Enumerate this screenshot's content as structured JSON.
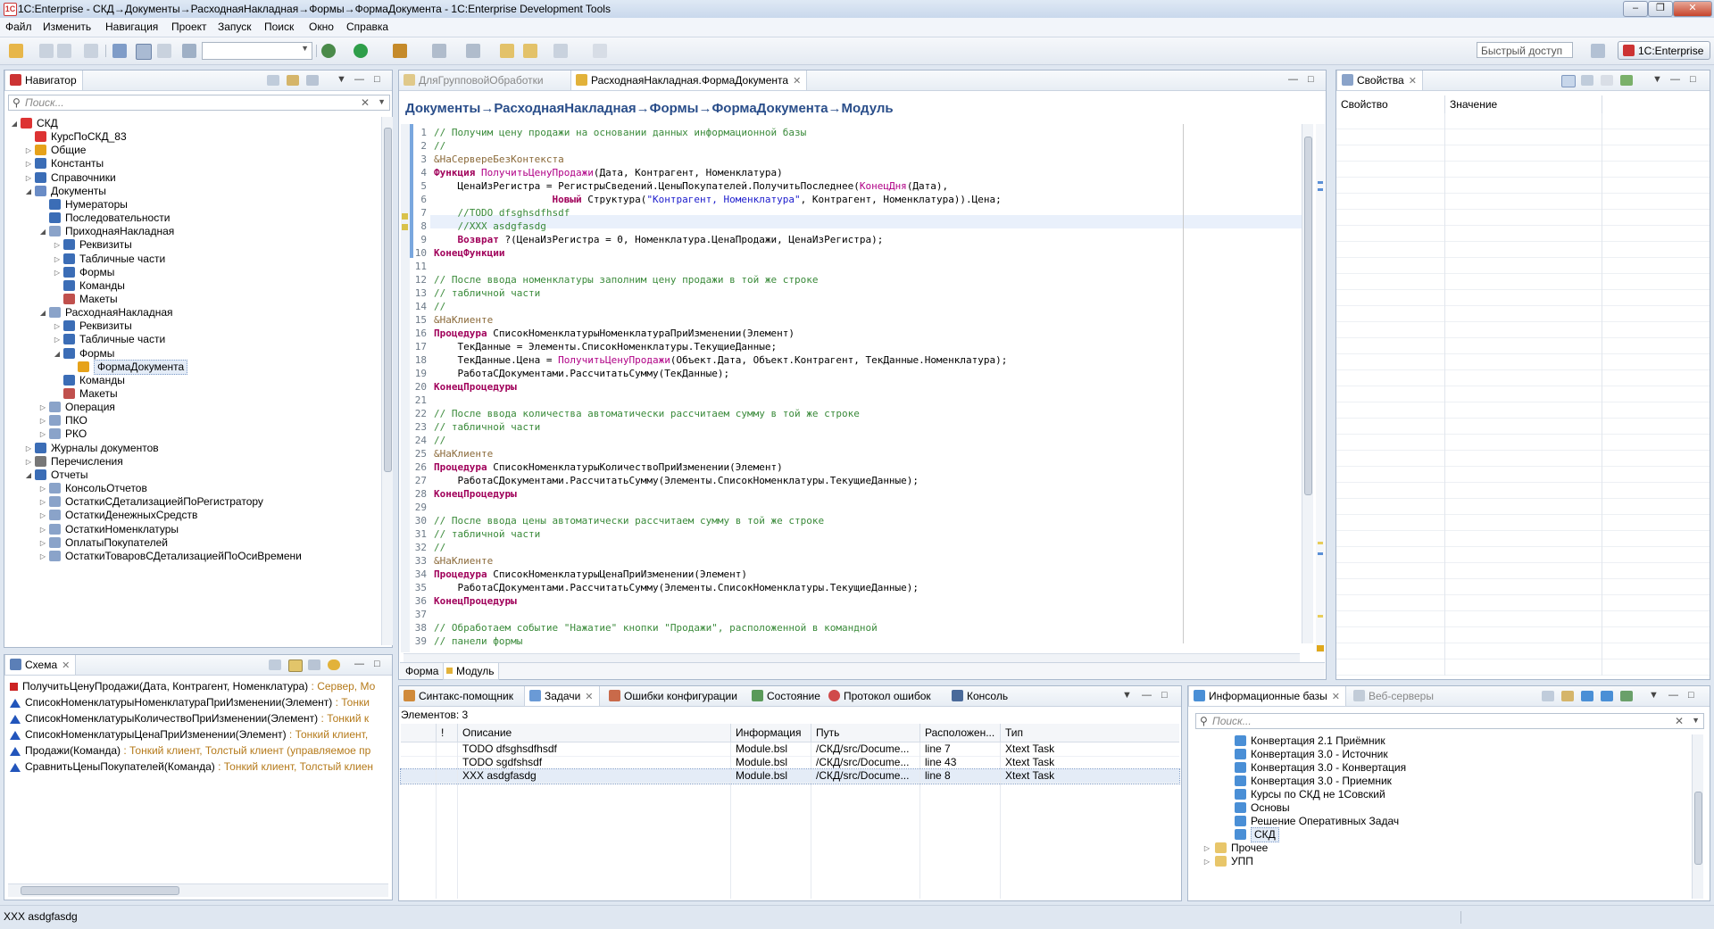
{
  "window": {
    "title": "1C:Enterprise - СКД→Документы→РасходнаяНакладная→Формы→ФормаДокумента - 1C:Enterprise Development Tools",
    "app_icon_text": "1C"
  },
  "menu": [
    "Файл",
    "Изменить",
    "Навигация",
    "Проект",
    "Запуск",
    "Поиск",
    "Окно",
    "Справка"
  ],
  "toolbar": {
    "quick_access_placeholder": "Быстрый доступ",
    "perspective": "1C:Enterprise"
  },
  "navigator": {
    "title": "Навигатор",
    "search_placeholder": "Поиск...",
    "items": [
      {
        "label": "СКД",
        "level": 0,
        "twisty": "open",
        "icon": "project-icon",
        "color": "#d33"
      },
      {
        "label": "КурсПоСКД_83",
        "level": 1,
        "twisty": "none",
        "icon": "config-icon",
        "color": "#d33"
      },
      {
        "label": "Общие",
        "level": 1,
        "twisty": "closed",
        "icon": "common-icon",
        "color": "#e6a21a"
      },
      {
        "label": "Константы",
        "level": 1,
        "twisty": "closed",
        "icon": "constants-icon",
        "color": "#3b6db6"
      },
      {
        "label": "Справочники",
        "level": 1,
        "twisty": "closed",
        "icon": "catalog-icon",
        "color": "#3b6db6"
      },
      {
        "label": "Документы",
        "level": 1,
        "twisty": "open",
        "icon": "documents-icon",
        "color": "#6a8cc6"
      },
      {
        "label": "Нумераторы",
        "level": 2,
        "twisty": "none",
        "icon": "numerator-icon",
        "color": "#3b6db6"
      },
      {
        "label": "Последовательности",
        "level": 2,
        "twisty": "none",
        "icon": "sequence-icon",
        "color": "#3b6db6"
      },
      {
        "label": "ПриходнаяНакладная",
        "level": 2,
        "twisty": "open",
        "icon": "document-icon",
        "color": "#8aa3c9"
      },
      {
        "label": "Реквизиты",
        "level": 3,
        "twisty": "closed",
        "icon": "attributes-icon",
        "color": "#3b6db6"
      },
      {
        "label": "Табличные части",
        "level": 3,
        "twisty": "closed",
        "icon": "table-icon",
        "color": "#3b6db6"
      },
      {
        "label": "Формы",
        "level": 3,
        "twisty": "closed",
        "icon": "forms-icon",
        "color": "#3b6db6"
      },
      {
        "label": "Команды",
        "level": 3,
        "twisty": "none",
        "icon": "commands-icon",
        "color": "#3b6db6"
      },
      {
        "label": "Макеты",
        "level": 3,
        "twisty": "none",
        "icon": "templates-icon",
        "color": "#c0504d"
      },
      {
        "label": "РасходнаяНакладная",
        "level": 2,
        "twisty": "open",
        "icon": "document-icon",
        "color": "#8aa3c9"
      },
      {
        "label": "Реквизиты",
        "level": 3,
        "twisty": "closed",
        "icon": "attributes-icon",
        "color": "#3b6db6"
      },
      {
        "label": "Табличные части",
        "level": 3,
        "twisty": "closed",
        "icon": "table-icon",
        "color": "#3b6db6"
      },
      {
        "label": "Формы",
        "level": 3,
        "twisty": "open",
        "icon": "forms-icon",
        "color": "#3b6db6"
      },
      {
        "label": "ФормаДокумента",
        "level": 4,
        "twisty": "none",
        "icon": "form-icon",
        "color": "#e6a21a",
        "selected": true
      },
      {
        "label": "Команды",
        "level": 3,
        "twisty": "none",
        "icon": "commands-icon",
        "color": "#3b6db6"
      },
      {
        "label": "Макеты",
        "level": 3,
        "twisty": "none",
        "icon": "templates-icon",
        "color": "#c0504d"
      },
      {
        "label": "Операция",
        "level": 2,
        "twisty": "closed",
        "icon": "document-icon",
        "color": "#8aa3c9"
      },
      {
        "label": "ПКО",
        "level": 2,
        "twisty": "closed",
        "icon": "document-icon",
        "color": "#8aa3c9"
      },
      {
        "label": "РКО",
        "level": 2,
        "twisty": "closed",
        "icon": "document-icon",
        "color": "#8aa3c9"
      },
      {
        "label": "Журналы документов",
        "level": 1,
        "twisty": "closed",
        "icon": "journal-icon",
        "color": "#3b6db6"
      },
      {
        "label": "Перечисления",
        "level": 1,
        "twisty": "closed",
        "icon": "enum-icon",
        "color": "#777"
      },
      {
        "label": "Отчеты",
        "level": 1,
        "twisty": "open",
        "icon": "reports-icon",
        "color": "#3b6db6"
      },
      {
        "label": "КонсольОтчетов",
        "level": 2,
        "twisty": "closed",
        "icon": "report-icon",
        "color": "#8aa3c9"
      },
      {
        "label": "ОстаткиСДетализациейПоРегистратору",
        "level": 2,
        "twisty": "closed",
        "icon": "report-icon",
        "color": "#8aa3c9"
      },
      {
        "label": "ОстаткиДенежныхСредств",
        "level": 2,
        "twisty": "closed",
        "icon": "report-icon",
        "color": "#8aa3c9"
      },
      {
        "label": "ОстаткиНоменклатуры",
        "level": 2,
        "twisty": "closed",
        "icon": "report-icon",
        "color": "#8aa3c9"
      },
      {
        "label": "ОплатыПокупателей",
        "level": 2,
        "twisty": "closed",
        "icon": "report-icon",
        "color": "#8aa3c9"
      },
      {
        "label": "ОстаткиТоваровСДетализациейПоОсиВремени",
        "level": 2,
        "twisty": "closed",
        "icon": "report-icon",
        "color": "#8aa3c9"
      }
    ]
  },
  "schema": {
    "title": "Схема",
    "items": [
      {
        "name": "ПолучитьЦенуПродажи(Дата, Контрагент, Номенклатура)",
        "meta": " : Сервер, Мо",
        "kind": "function",
        "color": "#cc2222"
      },
      {
        "name": "СписокНоменклатурыНоменклатураПриИзменении(Элемент)",
        "meta": " : Тонки",
        "kind": "procedure",
        "color": "#2255bb"
      },
      {
        "name": "СписокНоменклатурыКоличествоПриИзменении(Элемент)",
        "meta": " : Тонкий к",
        "kind": "procedure",
        "color": "#2255bb"
      },
      {
        "name": "СписокНоменклатурыЦенаПриИзменении(Элемент)",
        "meta": " : Тонкий клиент,",
        "kind": "procedure",
        "color": "#2255bb"
      },
      {
        "name": "Продажи(Команда)",
        "meta": " : Тонкий клиент, Толстый клиент (управляемое пр",
        "kind": "procedure",
        "color": "#2255bb"
      },
      {
        "name": "СравнитьЦеныПокупателей(Команда)",
        "meta": " : Тонкий клиент, Толстый клиен",
        "kind": "procedure",
        "color": "#2255bb"
      }
    ]
  },
  "editor": {
    "tabs": [
      {
        "label": "ДляГрупповойОбработки",
        "active": false
      },
      {
        "label": "РасходнаяНакладная.ФормаДокумента",
        "active": true
      }
    ],
    "breadcrumb": "Документы→РасходнаяНакладная→Формы→ФормаДокумента→Модуль",
    "bottom_tabs": [
      "Форма",
      "Модуль"
    ],
    "lines": [
      "// Получим цену продажи на основании данных информационной базы",
      "//",
      "&НаСервереБезКонтекста",
      "Функция ПолучитьЦенуПродажи(Дата, Контрагент, Номенклатура)",
      "    ЦенаИзРегистра = РегистрыСведений.ЦеныПокупателей.ПолучитьПоследнее(КонецДня(Дата),",
      "                    Новый Структура(\"Контрагент, Номенклатура\", Контрагент, Номенклатура)).Цена;",
      "    //TODO dfsghsdfhsdf",
      "    //XXX asdgfasdg",
      "    Возврат ?(ЦенаИзРегистра = 0, Номенклатура.ЦенаПродажи, ЦенаИзРегистра);",
      "КонецФункции",
      "",
      "// После ввода номенклатуры заполним цену продажи в той же строке",
      "// табличной части",
      "//",
      "&НаКлиенте",
      "Процедура СписокНоменклатурыНоменклатураПриИзменении(Элемент)",
      "    ТекДанные = Элементы.СписокНоменклатуры.ТекущиеДанные;",
      "    ТекДанные.Цена = ПолучитьЦенуПродажи(Объект.Дата, Объект.Контрагент, ТекДанные.Номенклатура);",
      "    РаботаСДокументами.РассчитатьСумму(ТекДанные);",
      "КонецПроцедуры",
      "",
      "// После ввода количества автоматически рассчитаем сумму в той же строке",
      "// табличной части",
      "//",
      "&НаКлиенте",
      "Процедура СписокНоменклатурыКоличествоПриИзменении(Элемент)",
      "    РаботаСДокументами.РассчитатьСумму(Элементы.СписокНоменклатуры.ТекущиеДанные);",
      "КонецПроцедуры",
      "",
      "// После ввода цены автоматически рассчитаем сумму в той же строке",
      "// табличной части",
      "//",
      "&НаКлиенте",
      "Процедура СписокНоменклатурыЦенаПриИзменении(Элемент)",
      "    РаботаСДокументами.РассчитатьСумму(Элементы.СписокНоменклатуры.ТекущиеДанные);",
      "КонецПроцедуры",
      "",
      "// Обработаем событие \"Нажатие\" кнопки \"Продажи\", расположенной в командной",
      "// панели формы"
    ]
  },
  "properties": {
    "title": "Свойства",
    "col_property": "Свойство",
    "col_value": "Значение"
  },
  "tasks": {
    "tabs": [
      "Синтакс-помощник",
      "Задачи",
      "Ошибки конфигурации",
      "Состояние",
      "Протокол ошибок",
      "Консоль"
    ],
    "count_label": "Элементов: 3",
    "columns": [
      "!",
      "Описание",
      "Информация",
      "Путь",
      "Расположен...",
      "Тип"
    ],
    "rows": [
      {
        "description": "TODO dfsghsdfhsdf",
        "info": "Module.bsl",
        "path": "/СКД/src/Docume...",
        "location": "line 7",
        "type": "Xtext Task"
      },
      {
        "description": "TODO sgdfshsdf",
        "info": "Module.bsl",
        "path": "/СКД/src/Docume...",
        "location": "line 43",
        "type": "Xtext Task"
      },
      {
        "description": "XXX asdgfasdg",
        "info": "Module.bsl",
        "path": "/СКД/src/Docume...",
        "location": "line 8",
        "type": "Xtext Task"
      }
    ]
  },
  "infobases": {
    "tabs": [
      "Информационные базы",
      "Веб-серверы"
    ],
    "search_placeholder": "Поиск...",
    "items": [
      {
        "label": "Конвертация 2.1 Приёмник",
        "level": 2,
        "icon": "infobase-icon"
      },
      {
        "label": "Конвертация 3.0 - Источник",
        "level": 2,
        "icon": "infobase-icon"
      },
      {
        "label": "Конвертация 3.0 - Конвертация",
        "level": 2,
        "icon": "infobase-icon"
      },
      {
        "label": "Конвертация 3.0 - Приемник",
        "level": 2,
        "icon": "infobase-icon"
      },
      {
        "label": "Курсы по СКД не 1Совский",
        "level": 2,
        "icon": "infobase-icon"
      },
      {
        "label": "Основы",
        "level": 2,
        "icon": "infobase-icon"
      },
      {
        "label": "Решение Оперативных Задач",
        "level": 2,
        "icon": "infobase-icon"
      },
      {
        "label": "СКД",
        "level": 2,
        "icon": "infobase-icon",
        "selected": true
      },
      {
        "label": "Прочее",
        "level": 1,
        "icon": "folder-icon"
      },
      {
        "label": "УПП",
        "level": 1,
        "icon": "folder-icon"
      }
    ]
  },
  "status": {
    "text": "XXX asdgfasdg"
  }
}
